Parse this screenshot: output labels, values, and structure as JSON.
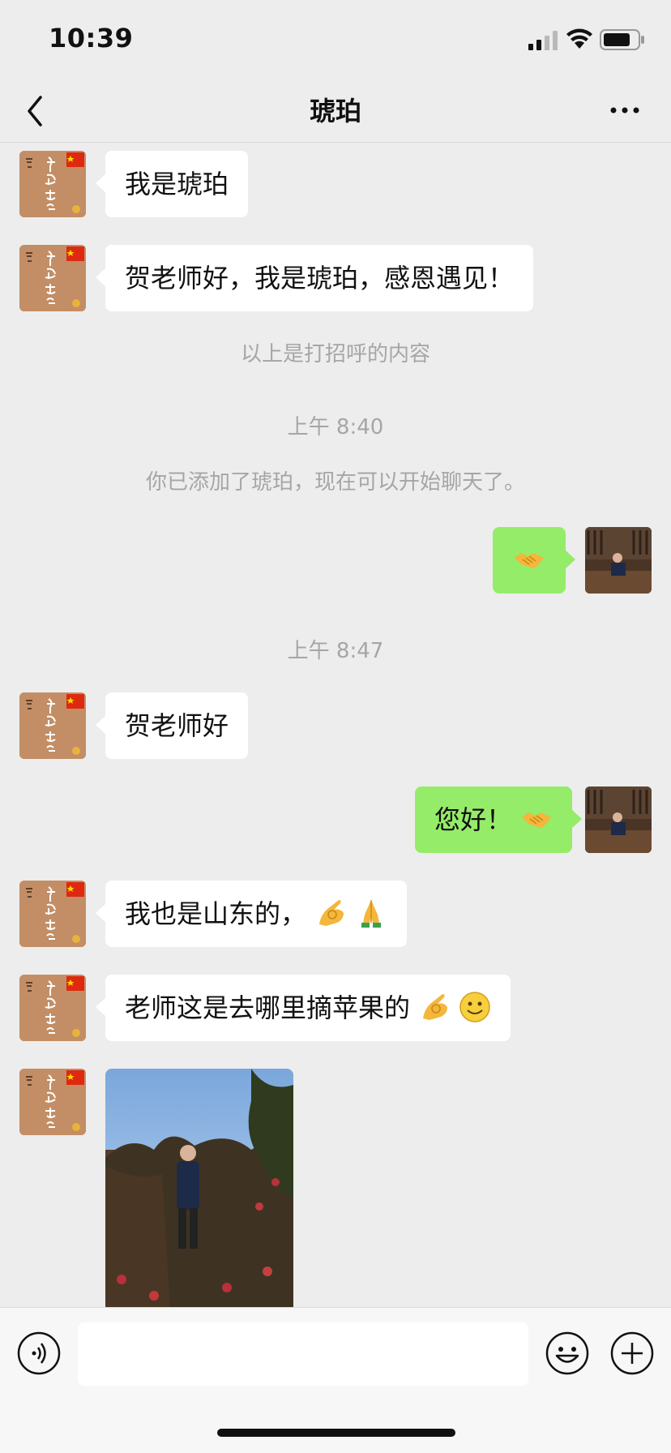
{
  "status_bar": {
    "time": "10:39"
  },
  "nav": {
    "title": "琥珀"
  },
  "messages": [
    {
      "side": "left",
      "text": "我是琥珀"
    },
    {
      "side": "left",
      "text": "贺老师好，我是琥珀，感恩遇见！"
    },
    {
      "type": "system",
      "text": "以上是打招呼的内容"
    },
    {
      "type": "timestamp",
      "text": "上午 8:40"
    },
    {
      "type": "system",
      "text": "你已添加了琥珀，现在可以开始聊天了。"
    },
    {
      "side": "right",
      "emoji": "handshake-emoji"
    },
    {
      "type": "timestamp",
      "text": "上午 8:47"
    },
    {
      "side": "left",
      "text": "贺老师好"
    },
    {
      "side": "right",
      "text": "您好！",
      "emoji": "handshake-emoji"
    },
    {
      "side": "left",
      "text": "我也是山东的，",
      "emoji": [
        "ok-hand-emoji",
        "pray-emoji"
      ]
    },
    {
      "side": "left",
      "text": "老师这是去哪里摘苹果的",
      "emoji": [
        "ok-hand-emoji",
        "smile-emoji"
      ]
    },
    {
      "side": "left",
      "image": "apple-orchard-photo"
    }
  ],
  "colors": {
    "background": "#ededed",
    "bubble_incoming": "#ffffff",
    "bubble_outgoing": "#95ec69",
    "system_text": "#a6a6a6"
  },
  "input": {
    "placeholder": ""
  }
}
